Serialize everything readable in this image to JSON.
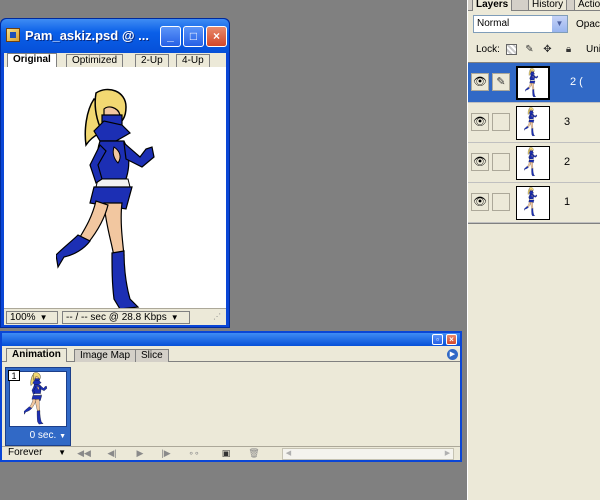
{
  "document_window": {
    "title": "Pam_askiz.psd @ ...",
    "controls": {
      "minimize": "_",
      "maximize": "□",
      "close": "×"
    },
    "view_tabs": [
      "Original",
      "Optimized",
      "2-Up",
      "4-Up"
    ],
    "active_view": "Original",
    "zoom": "100%",
    "download_info": "-- / -- sec @ 28.8 Kbps"
  },
  "layers_palette": {
    "tabs": [
      "Layers",
      "History",
      "Actio"
    ],
    "active_tab": "Layers",
    "blend_mode": "Normal",
    "opacity_label": "Opac",
    "lock_label": "Lock:",
    "unify_label": "Unif",
    "layers": [
      {
        "name": "2 (",
        "selected": true,
        "visible": true,
        "brush": true
      },
      {
        "name": "3",
        "selected": false,
        "visible": true,
        "brush": false
      },
      {
        "name": "2",
        "selected": false,
        "visible": true,
        "brush": false
      },
      {
        "name": "1",
        "selected": false,
        "visible": true,
        "brush": false
      }
    ]
  },
  "animation_palette": {
    "tabs": [
      "Animation",
      "Image Map",
      "Slice"
    ],
    "active_tab": "Animation",
    "frames": [
      {
        "number": "1",
        "delay": "0 sec."
      }
    ],
    "loop": "Forever"
  },
  "colors": {
    "xp_blue": "#0a46d6",
    "selection_blue": "#3169c6",
    "panel_bg": "#ece9d8",
    "workspace": "#808080",
    "costume_blue": "#1c2fb4",
    "skin": "#f2c7a0",
    "hair": "#f2d872"
  }
}
